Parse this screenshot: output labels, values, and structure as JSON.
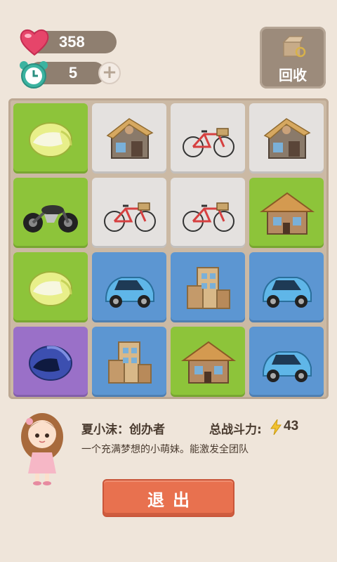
{
  "header": {
    "hearts": "358",
    "timer_count": "5",
    "plus_symbol": "+",
    "recycle_label": "回收"
  },
  "board": {
    "rows": [
      [
        "helmet-yellow",
        "shop",
        "bicycle",
        "shop"
      ],
      [
        "motorcycle",
        "bicycle",
        "bicycle",
        "house"
      ],
      [
        "helmet-yellow",
        "car",
        "building",
        "car"
      ],
      [
        "helmet-purple",
        "building",
        "house",
        "car"
      ]
    ],
    "tile_colors": [
      [
        "green",
        "gray",
        "gray",
        "gray"
      ],
      [
        "green",
        "gray",
        "gray",
        "green"
      ],
      [
        "green",
        "blue",
        "blue",
        "blue"
      ],
      [
        "purple",
        "blue",
        "green",
        "blue"
      ]
    ]
  },
  "profile": {
    "name": "夏小沫：创办者",
    "power_label": "总战斗力:",
    "power_value": "43",
    "description": "一个充满梦想的小萌妹。能激发全团队"
  },
  "exit_label": "退出",
  "colors": {
    "green": "#8dc43a",
    "gray": "#e4e1df",
    "blue": "#5c96d2",
    "purple": "#9a70c8",
    "exit": "#e8714f"
  }
}
